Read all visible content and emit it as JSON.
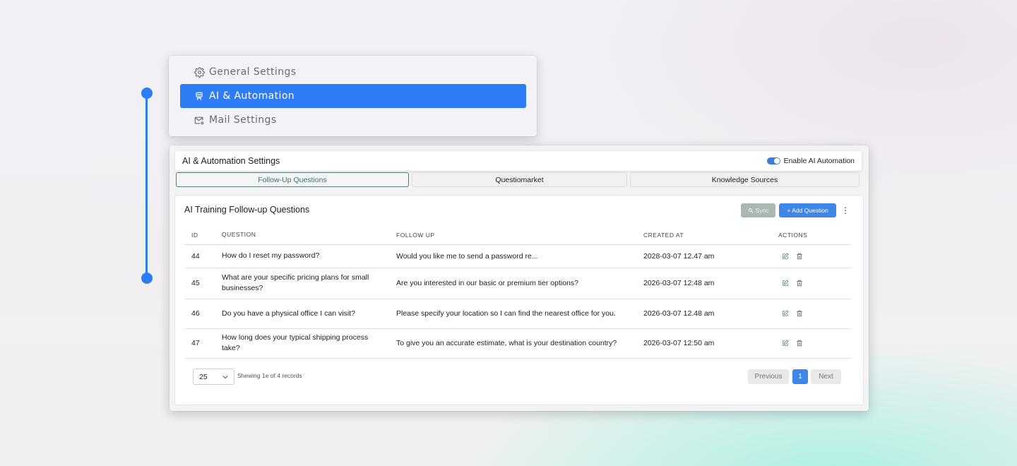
{
  "menu": {
    "items": [
      {
        "label": "General Settings",
        "icon": "gear-icon"
      },
      {
        "label": "AI & Automation",
        "icon": "robot-icon",
        "active": true
      },
      {
        "label": "Mail Settings",
        "icon": "mail-settings-icon"
      }
    ]
  },
  "panel": {
    "title": "AI & Automation Settings",
    "toggle_label": "Enable AI Automation",
    "toggle_on": true,
    "tabs": [
      {
        "label": "Follow-Up Questions",
        "active": true
      },
      {
        "label": "Questiomarket"
      },
      {
        "label": "Knowledge Sources"
      }
    ],
    "section_title": "AI Training Follow-up Questions",
    "sync_label": "Sync",
    "add_label": "+ Add Question",
    "table": {
      "headers": [
        "ID",
        "QUESTION",
        "FOLLOW UP",
        "CREATED AT",
        "ACTIONS"
      ],
      "rows": [
        {
          "id": "44",
          "question": "How do I reset my password?",
          "follow_up": "Would you like me to send a password re...",
          "created_at": "2028-03-07 12.47 am"
        },
        {
          "id": "45",
          "question": "What are your specific pricing plans for small businesses?",
          "follow_up": "Are you interested in our basic or premium tier options?",
          "created_at": "2026-03-07 12:48 am"
        },
        {
          "id": "46",
          "question": "Do you have a physical office I can visit?",
          "follow_up": "Please specify your location so I can find the nearest office for you.",
          "created_at": "2026-03-07 12.48 am"
        },
        {
          "id": "47",
          "question": "How long does your typical shipping process take?",
          "follow_up": "To give you an accurate estimate, what is your destination country?",
          "created_at": "2026-03-07 12:50 am"
        }
      ]
    },
    "pager": {
      "page_size": "25",
      "info": "Shewing 1e of 4 records",
      "prev_label": "Previous",
      "current_page": "1",
      "next_label": "Next"
    }
  },
  "colors": {
    "accent": "#2f7df6",
    "add_button": "#3e86e8",
    "sync_button": "#a9b8b0",
    "active_tab_text": "#3e6c73"
  }
}
